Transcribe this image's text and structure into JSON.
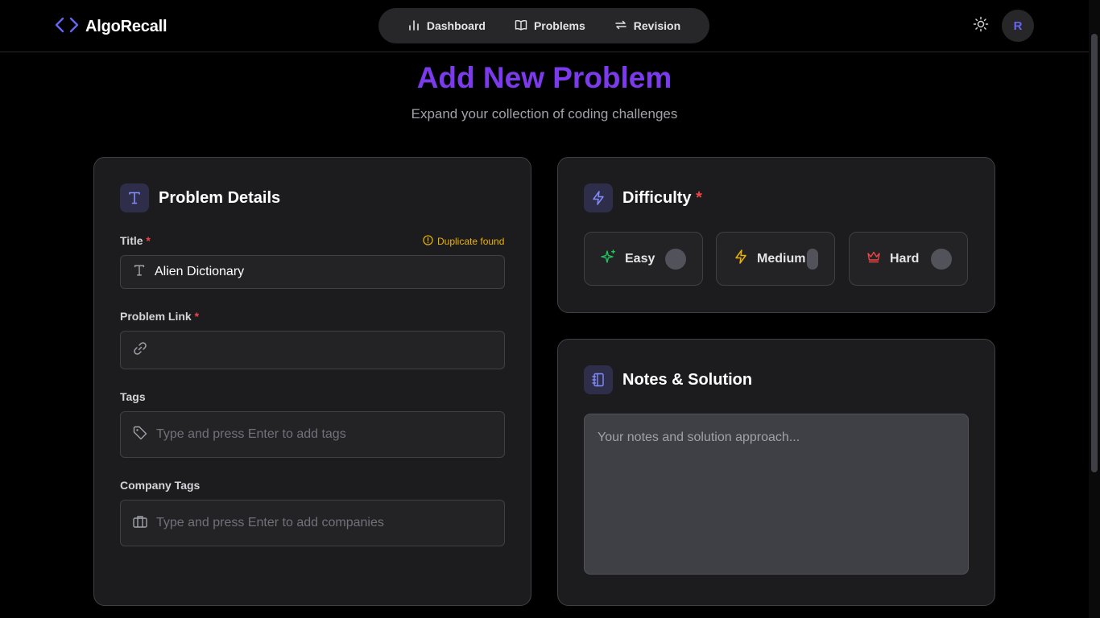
{
  "brand": {
    "name": "AlgoRecall",
    "icon": "code-brackets-icon",
    "accent": "#6366f1"
  },
  "nav": [
    {
      "label": "Dashboard",
      "icon": "bar-chart-icon"
    },
    {
      "label": "Problems",
      "icon": "book-open-icon"
    },
    {
      "label": "Revision",
      "icon": "repeat-icon"
    }
  ],
  "header": {
    "theme_icon": "sun-icon",
    "avatar_initial": "R"
  },
  "page": {
    "title": "Add New Problem",
    "subtitle": "Expand your collection of coding challenges",
    "title_color": "#7c3aed"
  },
  "details": {
    "heading": "Problem Details",
    "title_label": "Title",
    "required_mark": "*",
    "duplicate_text": "Duplicate found",
    "title_value": "Alien Dictionary",
    "link_label": "Problem Link",
    "link_value": "",
    "tags_label": "Tags",
    "tags_placeholder": "Type and press Enter to add tags",
    "company_label": "Company Tags",
    "company_placeholder": "Type and press Enter to add companies"
  },
  "difficulty": {
    "heading": "Difficulty",
    "options": [
      {
        "label": "Easy",
        "color": "#22c55e",
        "icon": "sparkles-icon"
      },
      {
        "label": "Medium",
        "color": "#eab308",
        "icon": "zap-icon"
      },
      {
        "label": "Hard",
        "color": "#ef4444",
        "icon": "crown-icon"
      }
    ]
  },
  "notes": {
    "heading": "Notes & Solution",
    "placeholder": "Your notes and solution approach..."
  }
}
